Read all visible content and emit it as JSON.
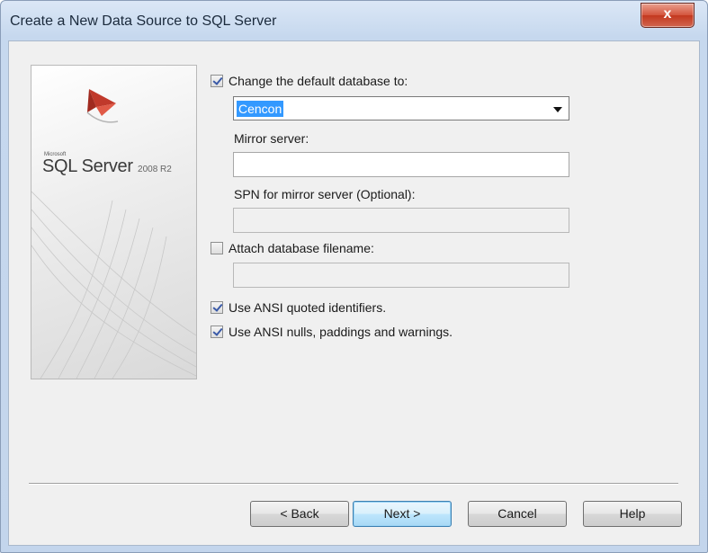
{
  "window": {
    "title": "Create a New Data Source to SQL Server",
    "close_symbol": "x"
  },
  "banner": {
    "small_text": "Microsoft",
    "brand": "SQL Server",
    "version": "2008 R2",
    "logo_icon": "sql-server-logo-icon"
  },
  "options": {
    "change_default_db": {
      "label": "Change the default database to:",
      "checked": true
    },
    "database": {
      "value": "Cencon"
    },
    "mirror_server": {
      "label": "Mirror server:",
      "value": ""
    },
    "spn_mirror": {
      "label": "SPN for mirror server (Optional):",
      "value": ""
    },
    "attach_db": {
      "label": "Attach database filename:",
      "checked": false,
      "value": ""
    },
    "ansi_quoted": {
      "label": "Use ANSI quoted identifiers.",
      "checked": true
    },
    "ansi_nulls": {
      "label": "Use ANSI nulls, paddings and warnings.",
      "checked": true
    }
  },
  "buttons": {
    "back": "< Back",
    "next": "Next >",
    "cancel": "Cancel",
    "help": "Help"
  },
  "colors": {
    "selection": "#3399ff",
    "close": "#c4381f",
    "accent": "#3c7fb1"
  }
}
